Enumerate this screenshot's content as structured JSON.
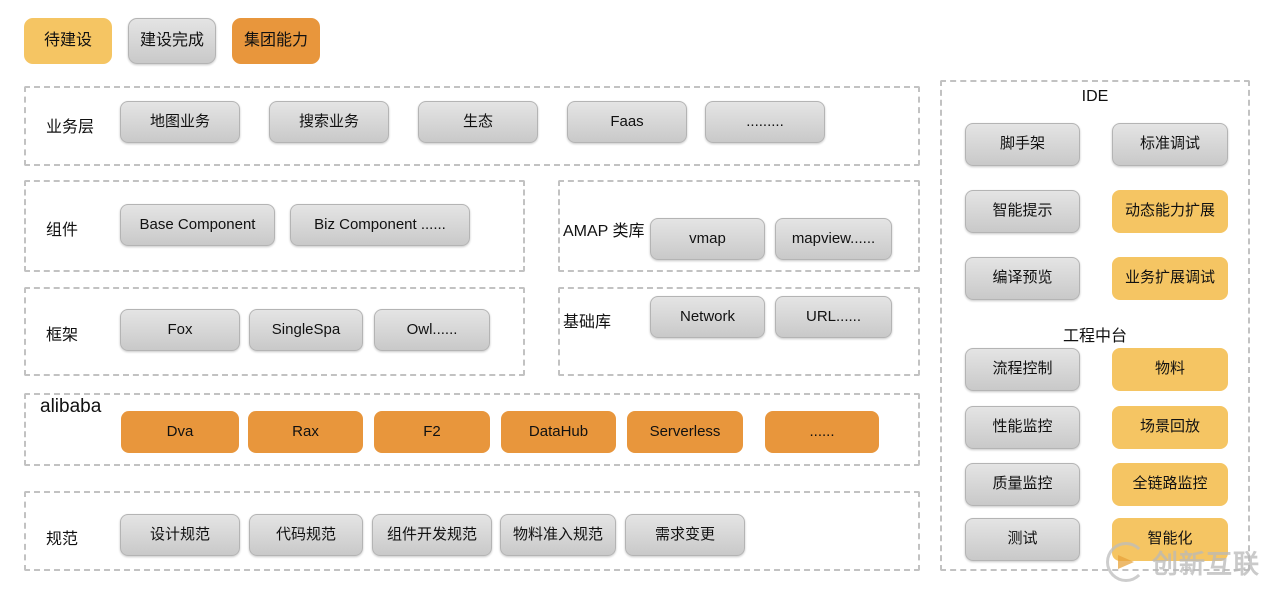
{
  "legend": {
    "items": [
      {
        "label": "待建设",
        "style": "yellow"
      },
      {
        "label": "建设完成",
        "style": "gray"
      },
      {
        "label": "集团能力",
        "style": "orange"
      }
    ]
  },
  "left_panel": {
    "rows": [
      {
        "label": "业务层",
        "boxes": [
          {
            "label": "地图业务",
            "style": "gray"
          },
          {
            "label": "搜索业务",
            "style": "gray"
          },
          {
            "label": "生态",
            "style": "gray"
          },
          {
            "label": "Faas",
            "style": "gray"
          },
          {
            "label": ".........",
            "style": "gray"
          }
        ]
      },
      {
        "label": "组件",
        "boxes": [
          {
            "label": "Base Component",
            "style": "gray"
          },
          {
            "label": "Biz Component ......",
            "style": "gray"
          }
        ]
      },
      {
        "label": "框架",
        "boxes": [
          {
            "label": "Fox",
            "style": "gray"
          },
          {
            "label": "SingleSpa",
            "style": "gray"
          },
          {
            "label": "Owl......",
            "style": "gray"
          }
        ]
      },
      {
        "label": "alibaba",
        "boxes": [
          {
            "label": "Dva",
            "style": "orange"
          },
          {
            "label": "Rax",
            "style": "orange"
          },
          {
            "label": "F2",
            "style": "orange"
          },
          {
            "label": "DataHub",
            "style": "orange"
          },
          {
            "label": "Serverless",
            "style": "orange"
          },
          {
            "label": "......",
            "style": "orange"
          }
        ]
      },
      {
        "label": "规范",
        "boxes": [
          {
            "label": "设计规范",
            "style": "gray"
          },
          {
            "label": "代码规范",
            "style": "gray"
          },
          {
            "label": "组件开发规范",
            "style": "gray"
          },
          {
            "label": "物料准入规范",
            "style": "gray"
          },
          {
            "label": "需求变更",
            "style": "gray"
          }
        ]
      }
    ],
    "side_rows": [
      {
        "label": "AMAP 类库",
        "boxes": [
          {
            "label": "vmap",
            "style": "gray"
          },
          {
            "label": "mapview......",
            "style": "gray"
          }
        ]
      },
      {
        "label": "基础库",
        "boxes": [
          {
            "label": "Network",
            "style": "gray"
          },
          {
            "label": "URL......",
            "style": "gray"
          }
        ]
      }
    ]
  },
  "right_panel": {
    "sections": [
      {
        "title": "IDE",
        "boxes": [
          {
            "label": "脚手架",
            "style": "gray"
          },
          {
            "label": "标准调试",
            "style": "gray"
          },
          {
            "label": "智能提示",
            "style": "gray"
          },
          {
            "label": "动态能力扩展",
            "style": "yellow"
          },
          {
            "label": "编译预览",
            "style": "gray"
          },
          {
            "label": "业务扩展调试",
            "style": "yellow"
          }
        ]
      },
      {
        "title": "工程中台",
        "boxes": [
          {
            "label": "流程控制",
            "style": "gray"
          },
          {
            "label": "物料",
            "style": "yellow"
          },
          {
            "label": "性能监控",
            "style": "gray"
          },
          {
            "label": "场景回放",
            "style": "yellow"
          },
          {
            "label": "质量监控",
            "style": "gray"
          },
          {
            "label": "全链路监控",
            "style": "yellow"
          },
          {
            "label": "测试",
            "style": "gray"
          },
          {
            "label": "智能化",
            "style": "yellow"
          }
        ]
      }
    ]
  },
  "watermark": {
    "text": "创新互联"
  },
  "colors": {
    "yellow": "#f5c563",
    "orange": "#e8963c",
    "gray_border": "#b4b4b4",
    "dash": "#c2c2c2"
  }
}
